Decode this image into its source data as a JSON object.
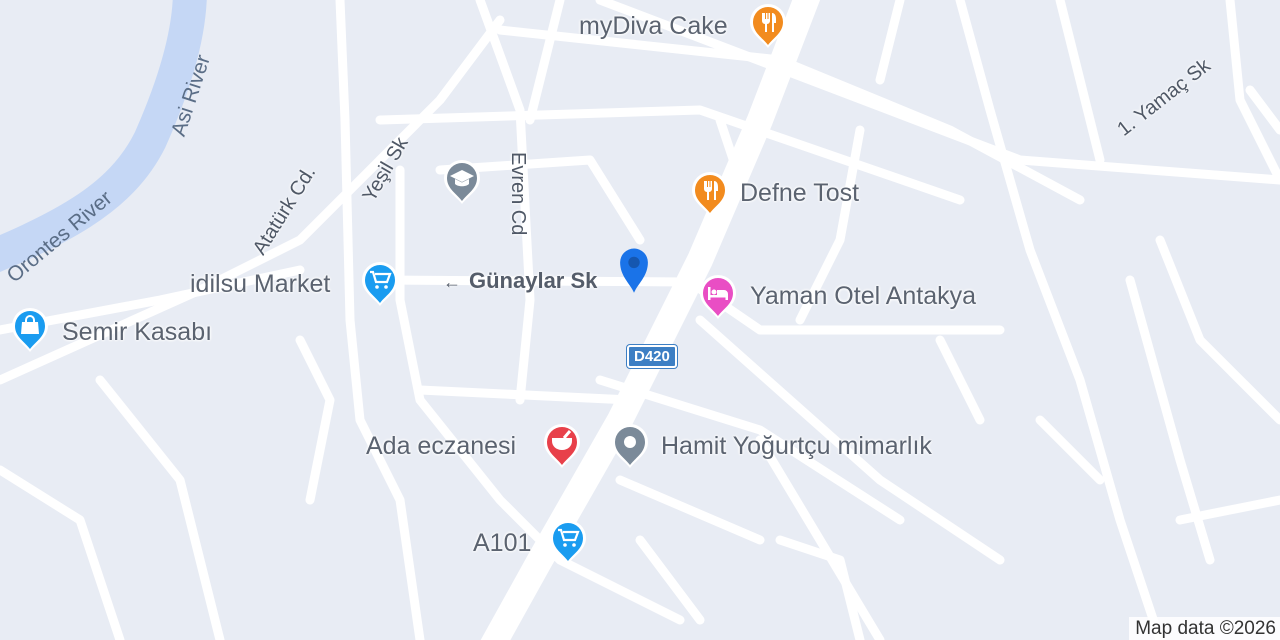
{
  "map": {
    "attribution": "Map data ©2026",
    "road_badge": "D420",
    "water_color": "#c5d7f5",
    "land_color": "#e8ecf4",
    "road_color": "#ffffff"
  },
  "water_labels": {
    "orontes": "Orontes River",
    "asi": "Asi River"
  },
  "streets": {
    "ataturk": "Atatürk Cd.",
    "yesil": "Yeşil Sk",
    "evren": "Evren Cd",
    "gunaylar": "Günaylar Sk",
    "yamac": "1. Yamaç Sk"
  },
  "places": {
    "mydiva": {
      "name": "myDiva Cake",
      "icon": "restaurant-icon",
      "color": "#f28b1e"
    },
    "defne": {
      "name": "Defne Tost",
      "icon": "restaurant-icon",
      "color": "#f28b1e"
    },
    "yaman": {
      "name": "Yaman Otel Antakya",
      "icon": "hotel-icon",
      "color": "#e94ec4"
    },
    "idilsu": {
      "name": "idilsu Market",
      "icon": "shopping-cart-icon",
      "color": "#1a9cf0"
    },
    "semir": {
      "name": "Semir Kasabı",
      "icon": "shopping-bag-icon",
      "color": "#1a9cf0"
    },
    "ada": {
      "name": "Ada eczanesi",
      "icon": "pharmacy-icon",
      "color": "#e8404a"
    },
    "hamit": {
      "name": "Hamit Yoğurtçu mimarlık",
      "icon": "place-icon",
      "color": "#7b8a99"
    },
    "a101": {
      "name": "A101",
      "icon": "shopping-cart-icon",
      "color": "#1a9cf0"
    },
    "school": {
      "icon": "school-icon",
      "color": "#7b8a99"
    }
  },
  "location_pin": {
    "icon": "location-pin-icon",
    "color": "#1a73e8"
  }
}
